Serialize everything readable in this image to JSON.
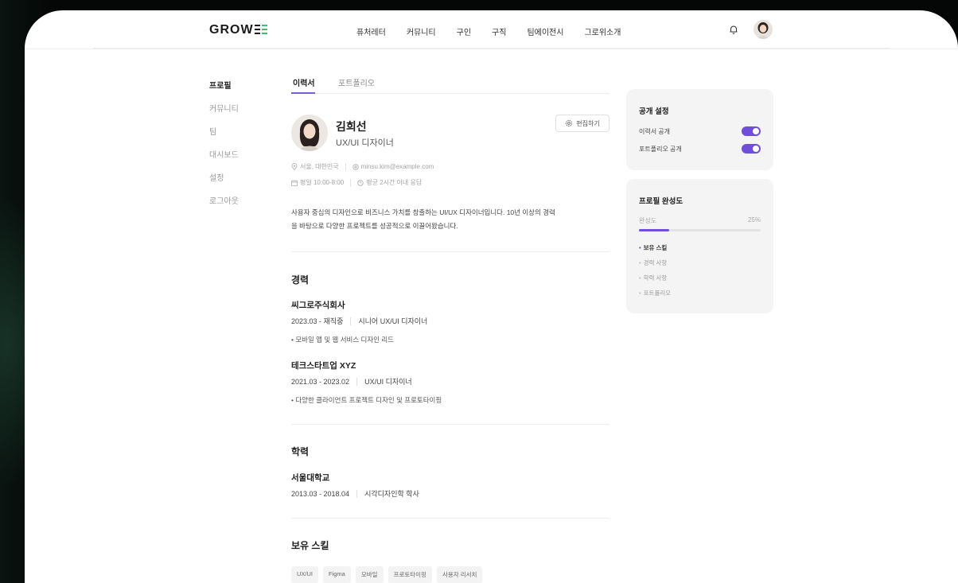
{
  "header": {
    "logo": "GROW",
    "nav": [
      "퓨처레터",
      "커뮤니티",
      "구인",
      "구직",
      "팀에이전시",
      "그로위소개"
    ]
  },
  "sidebar": {
    "items": [
      "프로필",
      "커뮤니티",
      "팀",
      "대시보드",
      "설정",
      "로그아웃"
    ]
  },
  "tabs": [
    "이력서",
    "포트폴리오"
  ],
  "profile": {
    "name": "김희선",
    "role": "UX/UI 디자이너",
    "edit_label": "편집하기",
    "location": "서울, 대한민국",
    "email": "minsu.kim@example.com",
    "hours": "평일 10:00-8:00",
    "response": "평균 2시간 이내 응답",
    "bio_line1": "사용자 중심의 디자인으로 비즈니스 가치를 창출하는 UI/UX 디자이너입니다. 10년 이상의 경력",
    "bio_line2": "을 바탕으로 다양한 프로젝트를 성공적으로 이끌어왔습니다."
  },
  "career": {
    "title": "경력",
    "items": [
      {
        "company": "씨그로주식회사",
        "period": "2023.03 - 재직중",
        "position": "시니어 UX/UI 디자이너",
        "desc": "• 모바일 앱 및 웹 서비스 디자인 리드"
      },
      {
        "company": "테크스타트업 XYZ",
        "period": "2021.03 - 2023.02",
        "position": "UX/UI 디자이너",
        "desc": "• 다양한 클라이언트 프로젝트 디자인 및 프로토타이핑"
      }
    ]
  },
  "education": {
    "title": "학력",
    "school": "서울대학교",
    "period": "2013.03 - 2018.04",
    "degree": "시각디자인학 학사"
  },
  "skills": {
    "title": "보유 스킬",
    "items": [
      "UX/UI",
      "Figma",
      "모바일",
      "프로토타이핑",
      "사용자 리서치"
    ]
  },
  "visibility": {
    "title": "공개 설정",
    "resume_label": "이력서 공개",
    "portfolio_label": "포트폴리오 공개",
    "resume_on": true,
    "portfolio_on": true
  },
  "completion": {
    "title": "프로필 완성도",
    "label": "완성도",
    "percent_text": "25%",
    "percent": 0.25,
    "checklist": [
      "보유 스킬",
      "경력 사항",
      "학력 사항",
      "포트폴리오"
    ]
  },
  "colors": {
    "accent": "#6f4fd8",
    "logo_green": "#3bbf6a"
  }
}
